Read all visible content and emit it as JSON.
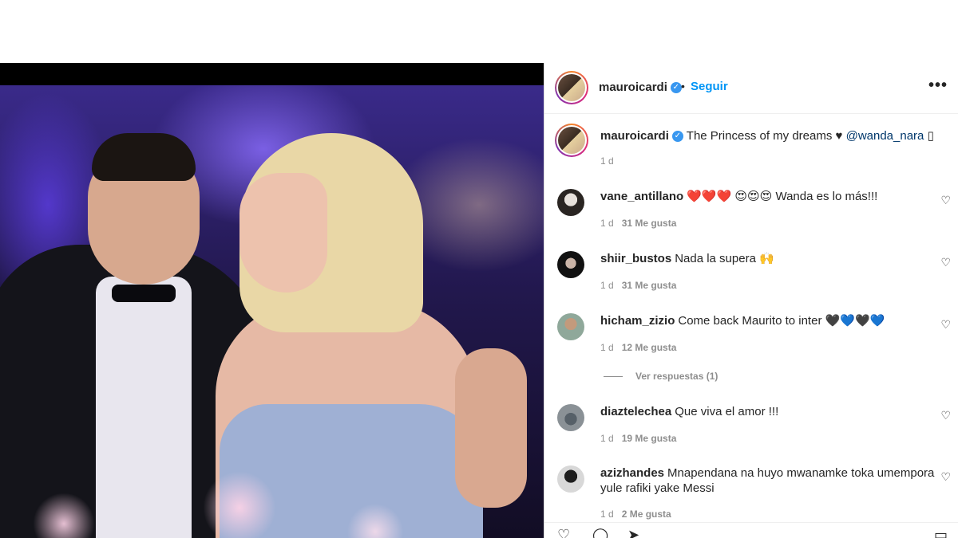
{
  "post": {
    "username": "mauroicardi",
    "verified_mark": "✓",
    "follow_separator": "•",
    "follow_label": "Seguir",
    "more_label": "•••"
  },
  "caption": {
    "username": "mauroicardi",
    "text": "The Princess of my dreams ♥",
    "mention": "@wanda_nara",
    "trailing": "▯",
    "time": "1 d"
  },
  "comments": [
    {
      "username": "vane_antillano",
      "text": "❤️❤️❤️ 😍😍😍 Wanda es lo más!!!",
      "time": "1 d",
      "likes": "31 Me gusta"
    },
    {
      "username": "shiir_bustos",
      "text": "Nada la supera 🙌",
      "time": "1 d",
      "likes": "31 Me gusta"
    },
    {
      "username": "hicham_zizio",
      "text": "Come back Maurito to inter 🖤💙🖤💙",
      "time": "1 d",
      "likes": "12 Me gusta",
      "replies": "Ver respuestas (1)"
    },
    {
      "username": "diaztelechea",
      "text": "Que viva el amor !!!",
      "time": "1 d",
      "likes": "19 Me gusta"
    },
    {
      "username": "azizhandes",
      "text": "Mnapendana na huyo mwanamke toka umempora yule rafiki yake Messi",
      "time": "1 d",
      "likes": "2 Me gusta"
    }
  ],
  "icons": {
    "like": "heart-icon",
    "comment": "comment-icon",
    "share": "share-icon",
    "save": "bookmark-icon"
  }
}
